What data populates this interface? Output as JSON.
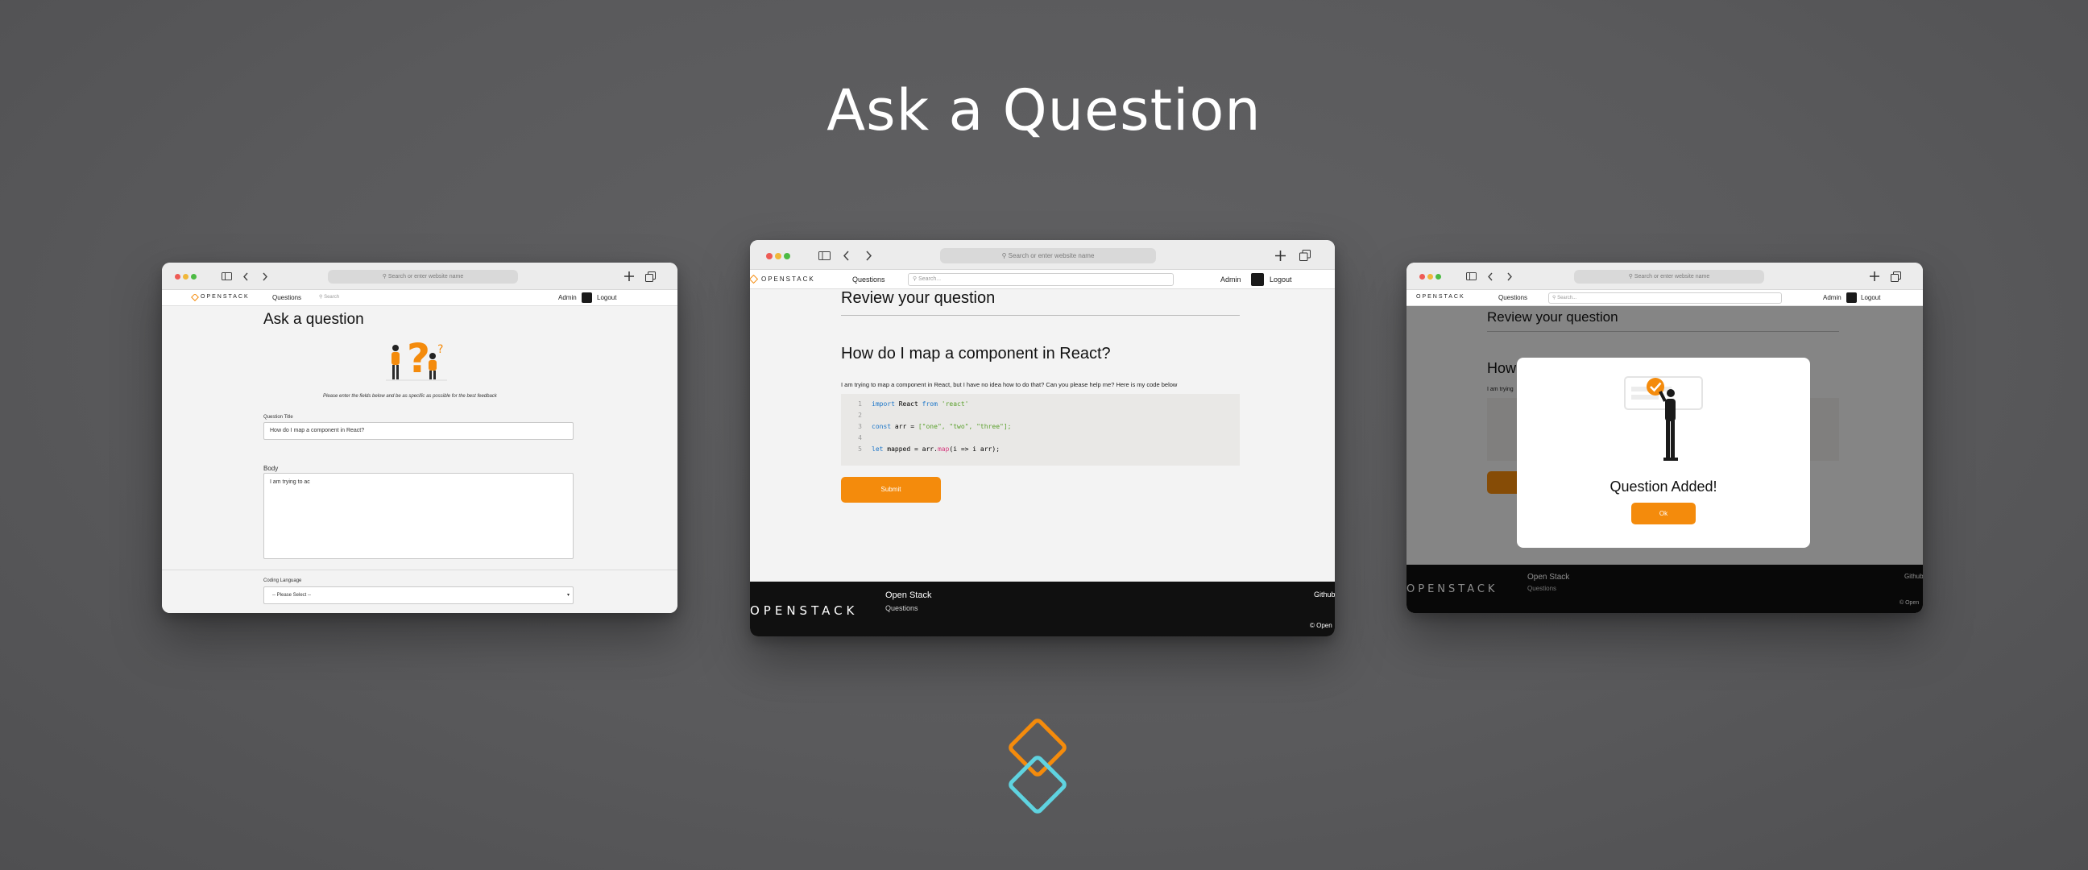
{
  "title": "Ask a Question",
  "browser": {
    "url_placeholder": "Search or enter website name"
  },
  "nav": {
    "brand": "OPENSTACK",
    "questions": "Questions",
    "search_placeholder": "Search...",
    "search_placeholder_short": "Search",
    "user": "Admin",
    "logout": "Logout"
  },
  "left": {
    "heading": "Ask a question",
    "hint": "Please enter the fields below and be as specific as possible for the best feedback",
    "question_title_label": "Question Title",
    "question_title_value": "How do I map a component in React?",
    "body_label": "Body",
    "body_value": "I am trying to ac",
    "language_label": "Coding Language",
    "language_value": "-- Please Select --"
  },
  "center": {
    "heading": "Review your question",
    "question_title": "How do I map a component in React?",
    "question_body": "I am trying to map a component in React, but I have no idea how to do that? Can you please help me? Here is my code below",
    "code": {
      "line_numbers": [
        "1",
        "2",
        "3",
        "4",
        "5"
      ],
      "l1_kw": "import",
      "l1_ident": "React",
      "l1_from": "from",
      "l1_str": "'react'",
      "l3_kw": "const",
      "l3_ident": "arr",
      "l3_op": "=",
      "l3_arr": "[\"one\", \"two\", \"three\"];",
      "l5_kw": "let",
      "l5_ident": "mapped",
      "l5_op": "=",
      "l5_obj": "arr.",
      "l5_fn": "map",
      "l5_rest": "(i => i arr);"
    },
    "submit": "Submit",
    "footer_brand": "OPENSTACK",
    "footer_title": "Open Stack",
    "footer_link": "Questions",
    "footer_github": "Github",
    "footer_copy": "© Open"
  },
  "right": {
    "heading": "Review your question",
    "partial_title": "How",
    "partial_body": "I am trying",
    "modal_message": "Question Added!",
    "modal_ok": "Ok",
    "footer_brand": "OPENSTACK",
    "footer_title": "Open Stack",
    "footer_link": "Questions",
    "footer_github": "Github",
    "footer_copy": "© Open"
  },
  "colors": {
    "accent": "#f48b0c",
    "logo_secondary": "#5fd3e0",
    "background": "#5a5a5c"
  }
}
